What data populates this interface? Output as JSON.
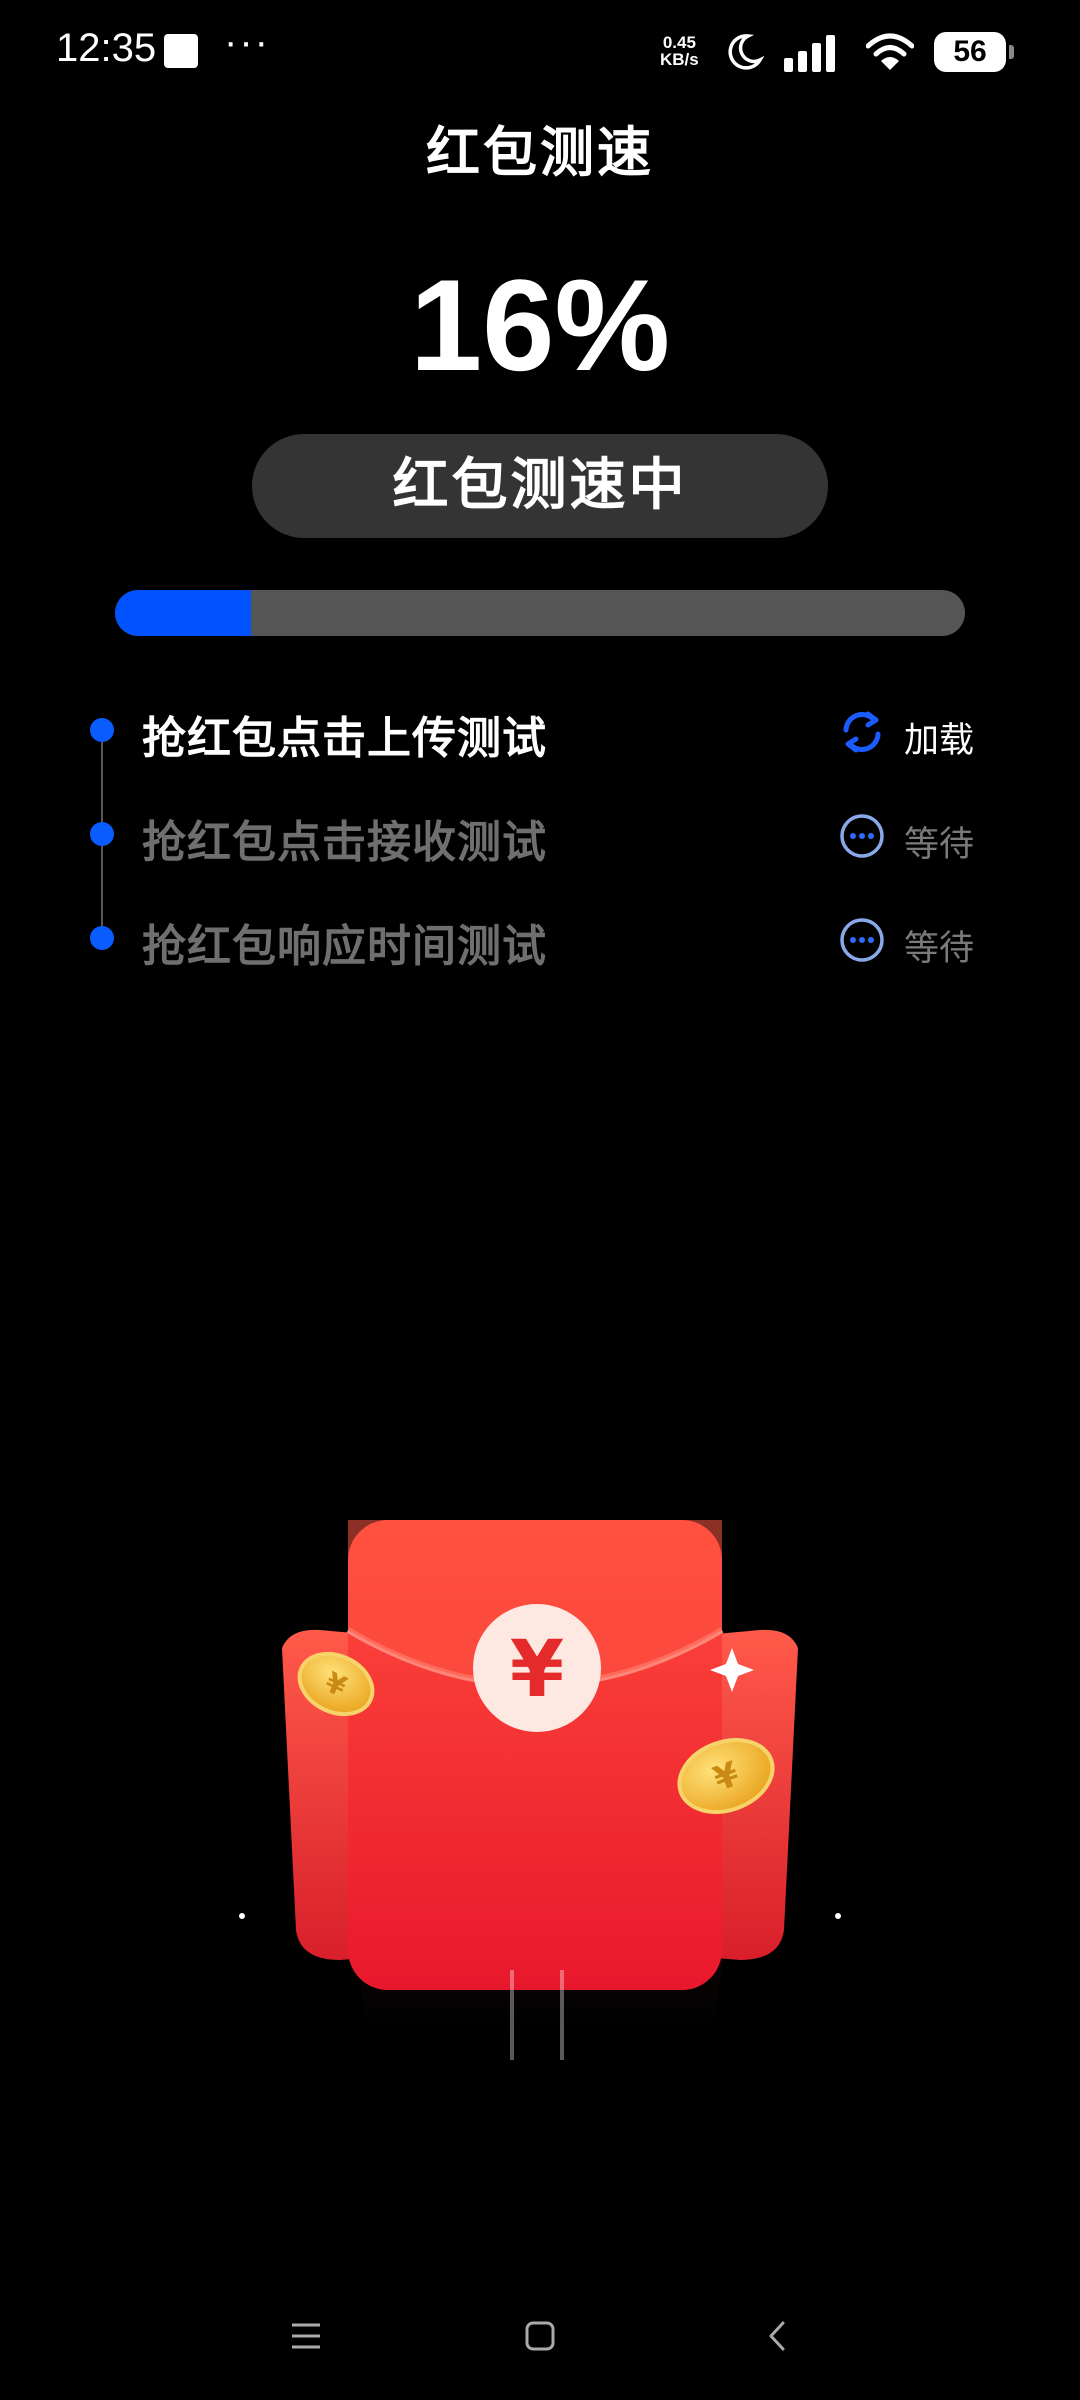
{
  "status_bar": {
    "time": "12:35",
    "overflow": "···",
    "speed_value": "0.45",
    "speed_unit": "KB/s",
    "battery": "56",
    "icons": [
      "notification-square-icon",
      "moon-icon",
      "signal-icon",
      "wifi-icon",
      "battery-icon"
    ]
  },
  "page": {
    "title": "红包测速",
    "percent_label": "16%",
    "progress_fraction": 0.16,
    "status_label": "红包测速中"
  },
  "steps": [
    {
      "label": "抢红包点击上传测试",
      "status": "加载",
      "state": "active",
      "icon": "refresh-icon"
    },
    {
      "label": "抢红包点击接收测试",
      "status": "等待",
      "state": "pending",
      "icon": "more-circle-icon"
    },
    {
      "label": "抢红包响应时间测试",
      "status": "等待",
      "state": "pending",
      "icon": "more-circle-icon"
    }
  ],
  "illustration": {
    "symbol": "¥",
    "icon": "red-envelope-icon"
  },
  "colors": {
    "accent": "#0052ff",
    "track": "#555555",
    "pill": "#343434",
    "envelope": "#ee2a2a",
    "coin": "#f2b72c"
  },
  "nav": {
    "icons": [
      "menu-icon",
      "home-icon",
      "back-icon"
    ]
  }
}
